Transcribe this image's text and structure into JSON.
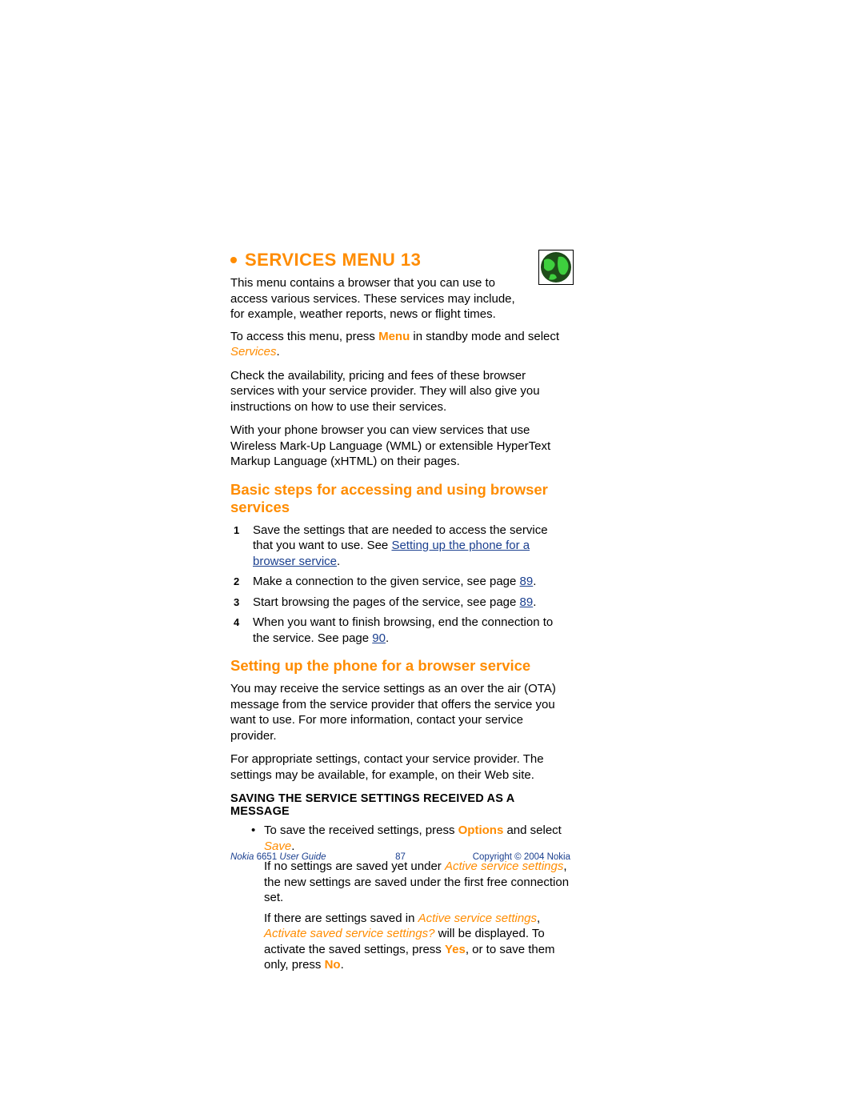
{
  "header": {
    "title": "SERVICES MENU 13"
  },
  "intro": "This menu contains a browser that you can use to access various services. These services may include, for example, weather reports, news or flight times.",
  "access_line": {
    "pre": "To access this menu, press ",
    "menu": "Menu",
    "mid": " in standby mode and select ",
    "services": "Services",
    "post": "."
  },
  "para1": "Check the availability, pricing and fees of these browser services with your service provider. They will also give you instructions on how to use their services.",
  "para2": "With your phone browser you can view services that use Wireless Mark-Up Language (WML) or extensible HyperText Markup Language (xHTML) on their pages.",
  "h2_basic": "Basic steps for accessing and using browser services",
  "steps": {
    "s1_pre": "Save the settings that are needed to access the service that you want to use. See ",
    "s1_link": "Setting up the phone for a browser service",
    "s1_post": ".",
    "s2_pre": "Make a connection to the given service, see page ",
    "s2_link": "89",
    "s2_post": ".",
    "s3_pre": "Start browsing the pages of the service, see page ",
    "s3_link": "89",
    "s3_post": ".",
    "s4_pre": "When you want to finish browsing, end the connection to the service. See page ",
    "s4_link": "90",
    "s4_post": "."
  },
  "h2_setup": "Setting up the phone for a browser service",
  "setup_p1": "You may receive the service settings as an over the air (OTA) message from the service provider that offers the service you want to use. For more information, contact your service provider.",
  "setup_p2": "For appropriate settings, contact your service provider. The settings may be available, for example, on their Web site.",
  "h3_saving": "SAVING THE SERVICE SETTINGS RECEIVED AS A MESSAGE",
  "bullet": {
    "line1_pre": "To save the received settings, press ",
    "line1_bold": "Options",
    "line1_mid": " and select ",
    "line1_save": "Save",
    "line1_post": ".",
    "line2_pre": "If no settings are saved yet under ",
    "line2_italic": "Active service settings",
    "line2_post": ", the new settings are saved under the first free connection set.",
    "line3_pre": "If there are settings saved in ",
    "line3_italic1": "Active service settings",
    "line3_mid1": ", ",
    "line3_italic2": "Activate saved service settings?",
    "line3_mid2": " will be displayed. To activate the saved settings, press ",
    "line3_yes": "Yes",
    "line3_mid3": ", or to save them only, press ",
    "line3_no": "No",
    "line3_post": "."
  },
  "footer": {
    "left_italic": "Nokia",
    "left_rest": " 6651 ",
    "left_italic2": "User Guide",
    "center": "87",
    "right": "Copyright © 2004 Nokia"
  }
}
